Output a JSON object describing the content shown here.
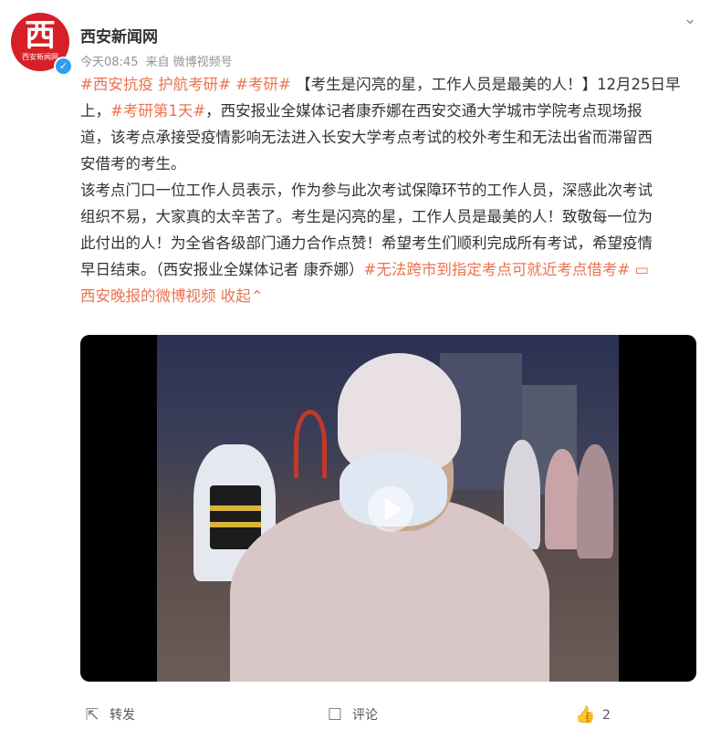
{
  "post": {
    "author": "西安新闻网",
    "avatar_glyph": "西",
    "avatar_brand": "西安新闻网",
    "time": "今天08:45",
    "source": "来自 微博视频号",
    "verified_icon": "verified-badge",
    "content": {
      "line1_tag1": "#西安抗疫 护航考研#",
      "line1_tag2": "#考研#",
      "line1_text": "【考生是闪亮的星，工作人员是最美的人！】12月25日早",
      "line2_prefix": "上，",
      "line2_tag": "#考研第1天#",
      "line2_text": "，西安报业全媒体记者康乔娜在西安交通大学城市学院考点现场报",
      "line3": "道，该考点承接受疫情影响无法进入长安大学考点考试的校外考生和无法出省而滞留西",
      "line4": "安借考的考生。",
      "p2_line1": "该考点门口一位工作人员表示，作为参与此次考试保障环节的工作人员，深感此次考试",
      "p2_line2": "组织不易，大家真的太辛苦了。考生是闪亮的星，工作人员是最美的人！致敬每一位为",
      "p2_line3": "此付出的人！为全省各级部门通力合作点赞！希望考生们顺利完成所有考试，希望疫情",
      "p2_line4_text": "早日结束。（西安报业全媒体记者 康乔娜）",
      "p2_line4_tag": "#无法跨市到指定考点可就近考点借考#",
      "video_link": "西安晚报的微博视频",
      "collapse": "收起"
    }
  },
  "actions": {
    "forward": "转发",
    "comment": "评论",
    "like_count": "2"
  },
  "colors": {
    "link": "#eb7350",
    "brand_red": "#d61f26",
    "verified_blue": "#2d9ef0"
  }
}
